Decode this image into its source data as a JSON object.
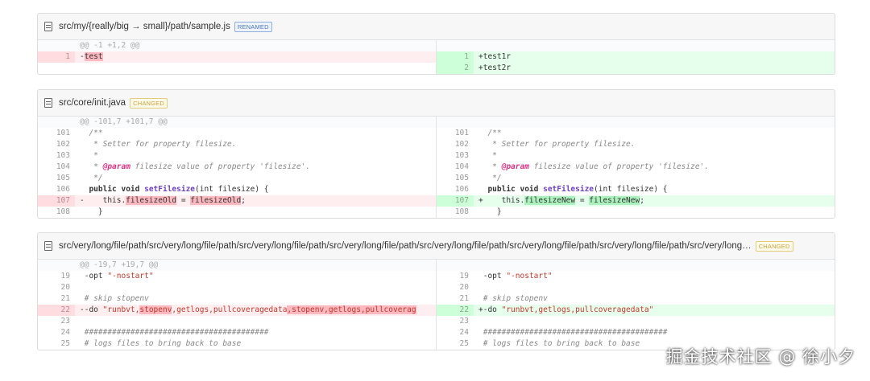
{
  "files": [
    {
      "path": "src/my/{really/big → small}/path/sample.js",
      "badge": "RENAMED",
      "hunk": "@@ -1 +1,2 @@",
      "left": [
        {
          "num": "1",
          "pre": "-",
          "text": "test"
        }
      ],
      "right": [
        {
          "num": "1",
          "text": "+test1r"
        },
        {
          "num": "2",
          "text": "+test2r"
        }
      ]
    },
    {
      "path": "src/core/init.java",
      "badge": "CHANGED",
      "hunk": "@@ -101,7 +101,7 @@",
      "lines": [
        {
          "num": "101",
          "text": "/**"
        },
        {
          "num": "102",
          "text": "* Setter for property filesize."
        },
        {
          "num": "103",
          "text": "*"
        },
        {
          "num": "104",
          "tag": "@param",
          "text": " filesize value of property 'filesize'."
        },
        {
          "num": "105",
          "text": "*/"
        },
        {
          "num": "106",
          "kw": "public void ",
          "fn": "setFilesize",
          "rest": "(int filesize) {"
        },
        {
          "num": "108",
          "text": "}"
        }
      ],
      "changed_num": "107",
      "del": {
        "pre": "-    this.",
        "a": "filesizeOld",
        "mid": " = ",
        "b": "filesizeOld",
        "post": ";"
      },
      "add": {
        "pre": "+    this.",
        "a": "filesizeNew",
        "mid": " = ",
        "b": "filesizeNew",
        "post": ";"
      }
    },
    {
      "path": "src/very/long/file/path/src/very/long/file/path/src/very/long/file/path/src/very/long/file/path/src/very/long/file/path/src/very/long/file/path/src/very/long/file/path/src/very/long…",
      "badge": "CHANGED",
      "hunk": "@@ -19,7 +19,7 @@",
      "opt": {
        "num": "19",
        "text": "-opt ",
        "str": "\"-nostart\""
      },
      "empty": [
        "20",
        "23"
      ],
      "comment": {
        "num": "21",
        "text": "# skip stopenv"
      },
      "changed_num": "22",
      "del": {
        "p1": "--do ",
        "s1": "\"runbvt,",
        "x1": "stopenv",
        "s2": ",getlogs,pullcoveragedata",
        "x2": ",stopenv,getlogs,pullcoverag"
      },
      "add": {
        "p1": "+-do ",
        "s1": "\"runbvt,getlogs,pullcoveragedata\""
      },
      "hashes": {
        "num": "24",
        "text": "########################################"
      },
      "logs": {
        "num": "25",
        "text": "# logs files to bring back to base"
      }
    }
  ],
  "watermark": "掘金技术社区 @ 徐小夕"
}
